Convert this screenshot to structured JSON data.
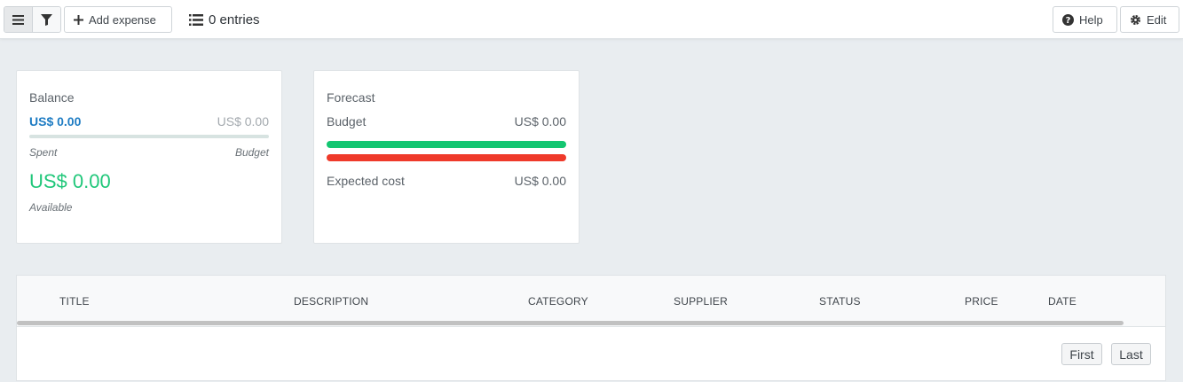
{
  "toolbar": {
    "add_expense_label": "Add expense",
    "entries_label": "0 entries",
    "help_label": "Help",
    "edit_label": "Edit",
    "icons": [
      "menu-icon",
      "filter-icon",
      "plus-icon",
      "list-icon",
      "question-circle-icon",
      "gear-icon"
    ]
  },
  "balance": {
    "title": "Balance",
    "spent_value": "US$ 0.00",
    "budget_value": "US$ 0.00",
    "spent_label": "Spent",
    "budget_label": "Budget",
    "available_value": "US$ 0.00",
    "available_label": "Available",
    "spent_fraction": 0
  },
  "forecast": {
    "title": "Forecast",
    "budget_label": "Budget",
    "budget_value": "US$ 0.00",
    "expected_label": "Expected cost",
    "expected_value": "US$ 0.00"
  },
  "table": {
    "columns": [
      "TITLE",
      "DESCRIPTION",
      "CATEGORY",
      "SUPPLIER",
      "STATUS",
      "PRICE",
      "DATE"
    ],
    "rows": []
  },
  "pager": {
    "first_label": "First",
    "last_label": "Last"
  },
  "colors": {
    "accent_blue": "#1e7cc3",
    "available_green": "#20c77a",
    "budget_bar_green": "#13c671",
    "expected_bar_red": "#ef3a2a"
  }
}
